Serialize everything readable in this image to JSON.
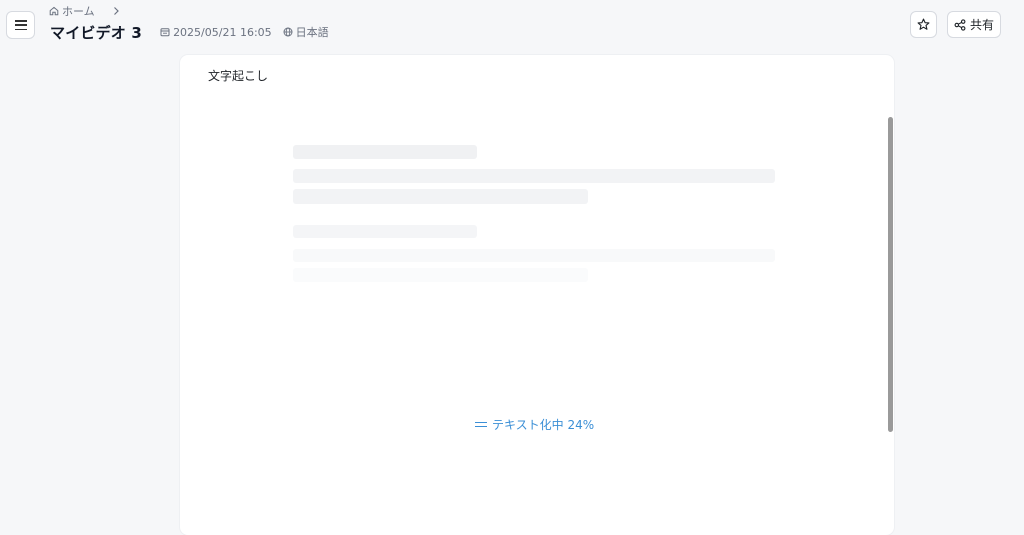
{
  "header": {
    "menu_icon": "hamburger-menu-icon",
    "breadcrumb": {
      "home_label": "ホーム",
      "home_icon": "home-icon",
      "separator_icon": "chevron-right-icon"
    },
    "title": "マイビデオ 3",
    "date": "2025/05/21 16:05",
    "date_icon": "calendar-icon",
    "language": "日本語",
    "language_icon": "globe-icon",
    "star_icon": "star-icon",
    "share": {
      "label": "共有",
      "icon": "share-icon"
    }
  },
  "transcript": {
    "title": "文字起こし",
    "status": {
      "text": "テキスト化中 24%",
      "progress_percent": 24,
      "icon": "equals-icon",
      "color": "#3b8fd6"
    }
  }
}
